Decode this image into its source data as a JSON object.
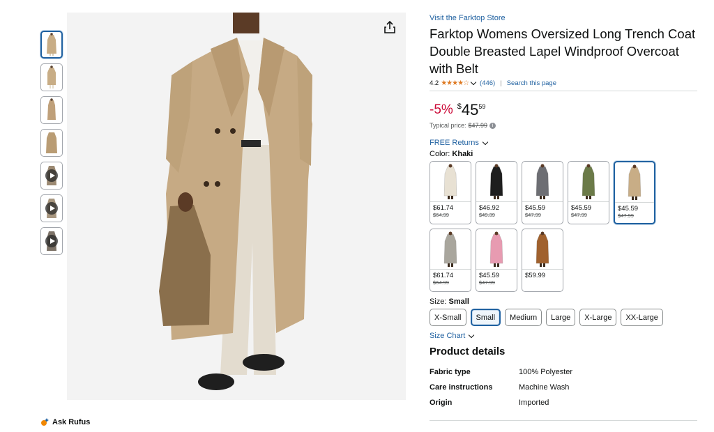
{
  "thumbnails": [
    {
      "kind": "image",
      "selected": true
    },
    {
      "kind": "image",
      "selected": false
    },
    {
      "kind": "image",
      "selected": false
    },
    {
      "kind": "image",
      "selected": false
    },
    {
      "kind": "video",
      "selected": false
    },
    {
      "kind": "video",
      "selected": false
    },
    {
      "kind": "video",
      "selected": false
    }
  ],
  "rufus": {
    "label": "Ask Rufus"
  },
  "product": {
    "store_link": "Visit the Farktop Store",
    "title": "Farktop Womens Oversized Long Trench Coat Double Breasted Lapel Windproof Overcoat with Belt",
    "rating": "4.2",
    "stars": "★★★★☆",
    "review_count": "(446)",
    "search_page": "Search this page",
    "separator": "|"
  },
  "price": {
    "discount": "-5%",
    "currency": "$",
    "whole": "45",
    "fraction": "59",
    "typical_label": "Typical price:",
    "typical_value": "$47.99",
    "info": "i"
  },
  "returns": {
    "label": "FREE Returns"
  },
  "color": {
    "label": "Color:",
    "selected": "Khaki",
    "swatches": [
      {
        "price": "$61.74",
        "orig": "$64.99",
        "coat": "#e8e1d3",
        "selected": false
      },
      {
        "price": "$46.92",
        "orig": "$49.39",
        "coat": "#1e1e1e",
        "selected": false
      },
      {
        "price": "$45.59",
        "orig": "$47.99",
        "coat": "#6d6e73",
        "selected": false
      },
      {
        "price": "$45.59",
        "orig": "$47.99",
        "coat": "#6b7a48",
        "selected": false
      },
      {
        "price": "$45.59",
        "orig": "$47.99",
        "coat": "#c8ad86",
        "selected": true
      },
      {
        "price": "$61.74",
        "orig": "$64.99",
        "coat": "#a9a69d",
        "selected": false
      },
      {
        "price": "$45.59",
        "orig": "$47.99",
        "coat": "#e79bb1",
        "selected": false
      },
      {
        "price": "$59.99",
        "orig": "",
        "coat": "#a0612e",
        "selected": false
      }
    ]
  },
  "size": {
    "label": "Size:",
    "selected": "Small",
    "options": [
      "X-Small",
      "Small",
      "Medium",
      "Large",
      "X-Large",
      "XX-Large"
    ],
    "size_chart": "Size Chart"
  },
  "details": {
    "title": "Product details",
    "rows": [
      {
        "key": "Fabric type",
        "value": "100% Polyester"
      },
      {
        "key": "Care instructions",
        "value": "Machine Wash"
      },
      {
        "key": "Origin",
        "value": "Imported"
      }
    ]
  },
  "colors": {
    "link": "#2162a1",
    "discount": "#cc0c39",
    "star": "#de7921"
  }
}
